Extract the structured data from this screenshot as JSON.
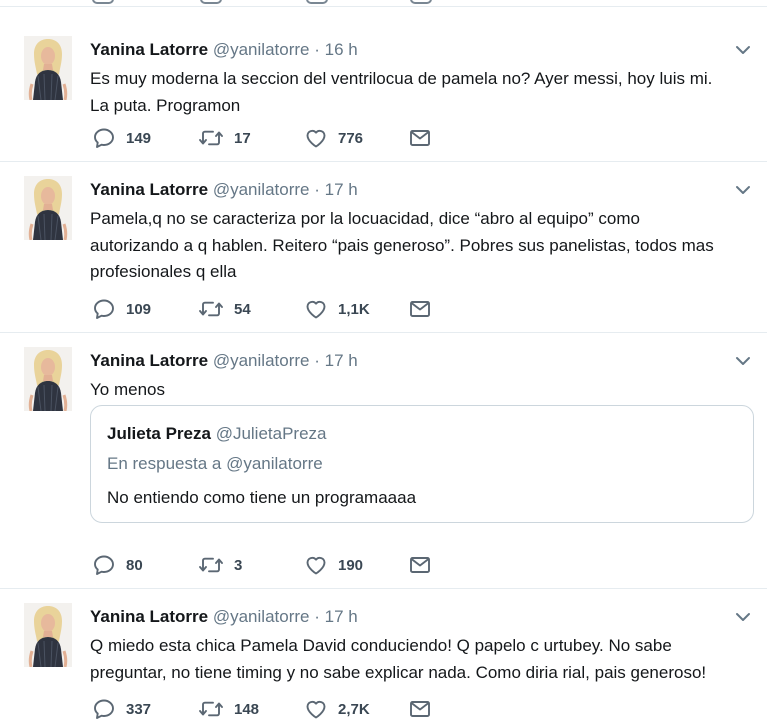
{
  "colors": {
    "name": "#14171a",
    "meta": "#657786",
    "icon": "#5b6773",
    "divider": "#e6ecf0"
  },
  "tweets": [
    {
      "name": "Yanina Latorre",
      "handle": "@yanilatorre",
      "separator": "·",
      "time": "16 h",
      "lines": [
        "Es muy moderna la seccion del ventrilocua de pamela no? Ayer messi, hoy luis mi.",
        "La puta. Programon"
      ],
      "replies": "149",
      "retweets": "17",
      "likes": "776"
    },
    {
      "name": "Yanina Latorre",
      "handle": "@yanilatorre",
      "separator": "·",
      "time": "17 h",
      "lines": [
        "Pamela,q no se caracteriza por la locuacidad, dice “abro al equipo” como",
        "autorizando a q hablen. Reitero “pais generoso”. Pobres sus panelistas, todos mas",
        "profesionales q ella"
      ],
      "replies": "109",
      "retweets": "54",
      "likes": "1,1K"
    },
    {
      "name": "Yanina Latorre",
      "handle": "@yanilatorre",
      "separator": "·",
      "time": "17 h",
      "lines": [
        "Yo menos"
      ],
      "quote": {
        "name": "Julieta Preza",
        "handle": "@JulietaPreza",
        "reply_to": "En respuesta a @yanilatorre",
        "text": "No entiendo como tiene un programaaaa"
      },
      "replies": "80",
      "retweets": "3",
      "likes": "190"
    },
    {
      "name": "Yanina Latorre",
      "handle": "@yanilatorre",
      "separator": "·",
      "time": "17 h",
      "lines": [
        "Q miedo esta chica Pamela David conduciendo! Q papelo c urtubey. No sabe",
        "preguntar, no tiene timing y no sabe explicar nada. Como diria rial, pais generoso!"
      ],
      "replies": "337",
      "retweets": "148",
      "likes": "2,7K"
    }
  ]
}
